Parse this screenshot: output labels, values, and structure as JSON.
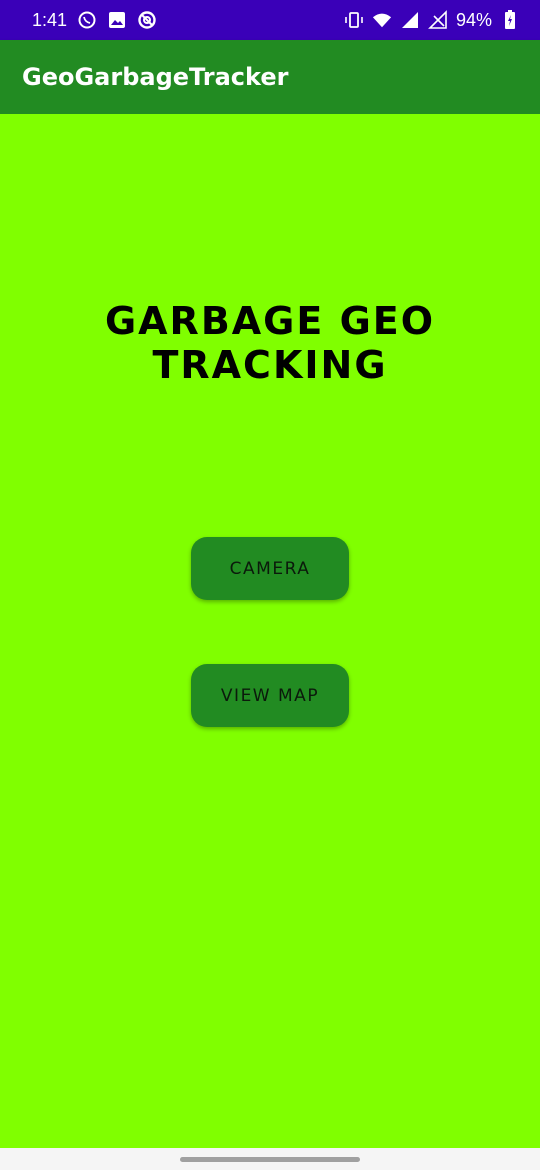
{
  "status_bar": {
    "time": "1:41",
    "battery": "94%",
    "icons": [
      "whatsapp-icon",
      "image-icon",
      "notification-icon",
      "vibrate-icon",
      "wifi-icon",
      "signal-icon",
      "no-signal-icon",
      "battery-icon"
    ]
  },
  "app_bar": {
    "title": "GeoGarbageTracker"
  },
  "main": {
    "logo_text": "GARBAGE GEO TRACKING",
    "camera_label": "CAMERA",
    "map_label": "VIEW MAP"
  },
  "colors": {
    "status_bar": "#3a00b8",
    "app_bar": "#228b22",
    "background": "#80ff00",
    "button": "#228b22"
  }
}
